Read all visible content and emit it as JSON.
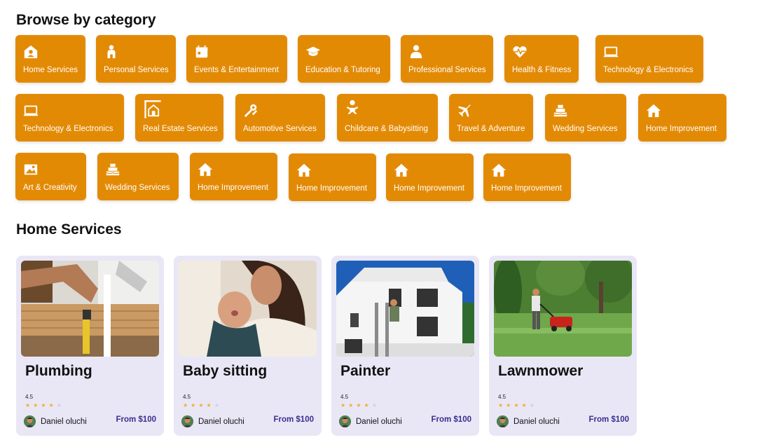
{
  "browse": {
    "title": "Browse by category"
  },
  "categories": [
    {
      "label": "Home Services",
      "icon": "house-user-icon"
    },
    {
      "label": "Personal Services",
      "icon": "person-icon"
    },
    {
      "label": "Events & Entertainment",
      "icon": "calendar-icon"
    },
    {
      "label": "Education & Tutoring",
      "icon": "graduation-cap-icon"
    },
    {
      "label": "Professional Services",
      "icon": "user-tie-icon"
    },
    {
      "label": "Health & Fitness",
      "icon": "heart-pulse-icon"
    },
    {
      "label": "Technology & Electronics",
      "icon": "laptop-icon"
    },
    {
      "label": "Technology & Electronics",
      "icon": "laptop-icon"
    },
    {
      "label": "Real Estate Services",
      "icon": "signpost-house-icon"
    },
    {
      "label": "Automotive Services",
      "icon": "tools-icon"
    },
    {
      "label": "Childcare & Babysitting",
      "icon": "baby-icon"
    },
    {
      "label": "Travel & Adventure",
      "icon": "airplane-icon"
    },
    {
      "label": "Wedding Services",
      "icon": "wedding-cake-icon"
    },
    {
      "label": "Home Improvement",
      "icon": "house-icon"
    },
    {
      "label": "Art & Creativity",
      "icon": "picture-icon"
    },
    {
      "label": "Wedding Services",
      "icon": "wedding-cake-icon"
    },
    {
      "label": "Home Improvement",
      "icon": "house-icon"
    },
    {
      "label": "Home Improvement",
      "icon": "house-icon"
    },
    {
      "label": "Home Improvement",
      "icon": "house-icon"
    },
    {
      "label": "Home Improvement",
      "icon": "house-icon"
    }
  ],
  "home_services": {
    "title": "Home Services",
    "cards": [
      {
        "title": "Plumbing",
        "rating": "4.5",
        "stars": 3.5,
        "provider": "Daniel oluchi",
        "price": "From $100",
        "photo": "plumbing-photo"
      },
      {
        "title": "Baby sitting",
        "rating": "4.5",
        "stars": 3.5,
        "provider": "Daniel oluchi",
        "price": "From $100",
        "photo": "baby-sitting-photo"
      },
      {
        "title": "Painter",
        "rating": "4.5",
        "stars": 3.5,
        "provider": "Daniel oluchi",
        "price": "From $100",
        "photo": "painter-photo"
      },
      {
        "title": "Lawnmower",
        "rating": "4.5",
        "stars": 3.5,
        "provider": "Daniel oluchi",
        "price": "From $100",
        "photo": "lawnmower-photo"
      }
    ]
  },
  "colors": {
    "category_tile": "#e38a05",
    "card_background": "#e9e7f6",
    "price_text": "#3a2f8f",
    "star_filled": "#f2b01e"
  }
}
